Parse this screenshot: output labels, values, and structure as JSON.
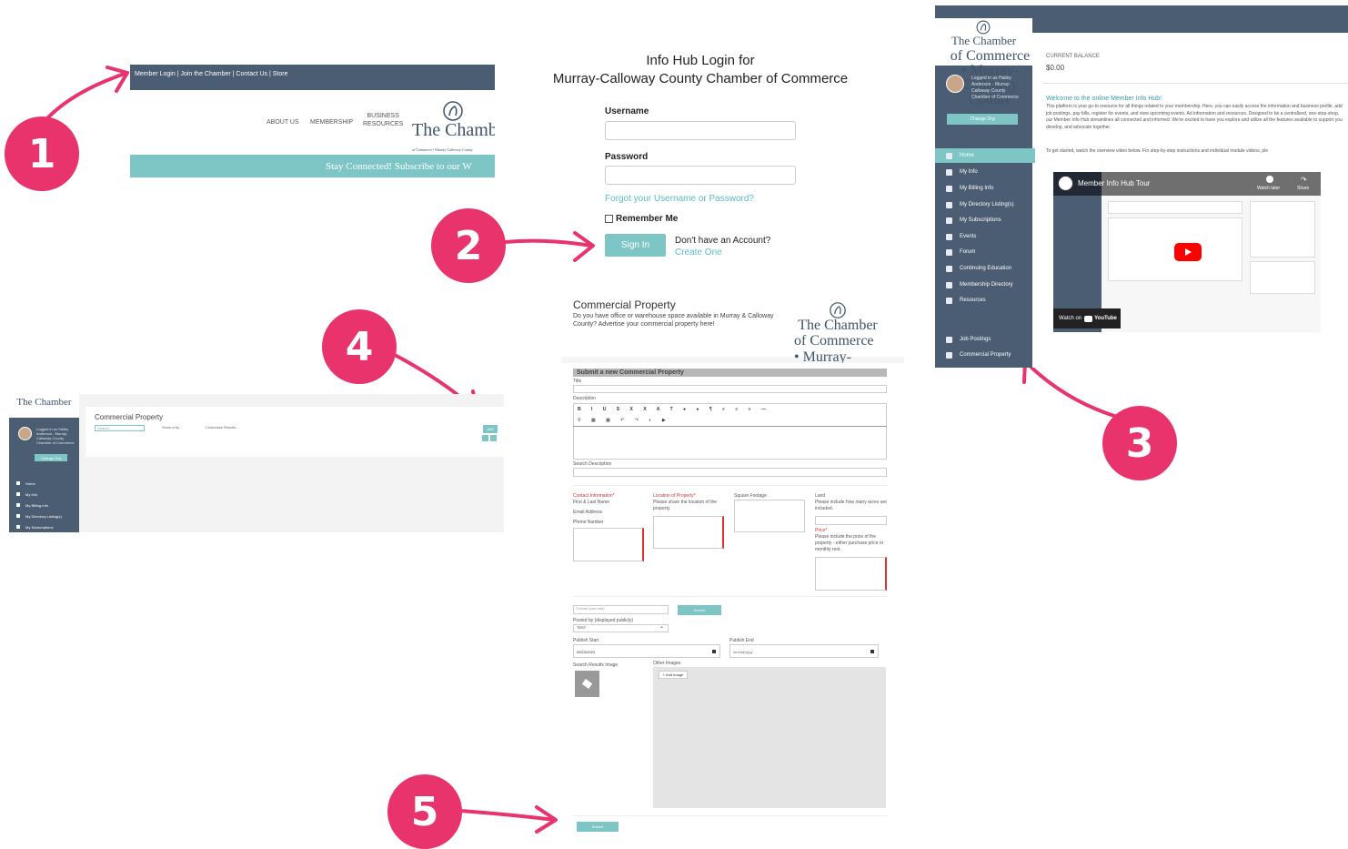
{
  "steps": [
    "1",
    "2",
    "3",
    "4",
    "5"
  ],
  "site": {
    "topbar": "Member Login | Join the Chamber | Contact Us | Store",
    "nav": [
      "ABOUT US",
      "MEMBERSHIP"
    ],
    "nav_business": [
      "BUSINESS",
      "RESOURCES"
    ],
    "logo": "The Chambe",
    "logo_sub": "of Commerce • Murray-Calloway County",
    "band": "Stay Connected! Subscribe to our W"
  },
  "login": {
    "title_line1": "Info Hub Login for",
    "title_line2": "Murray-Calloway County Chamber of Commerce",
    "username_label": "Username",
    "password_label": "Password",
    "forgot": "Forgot your Username or Password?",
    "remember": "Remember Me",
    "signin": "Sign In",
    "no_account": "Don't have an Account?",
    "create": "Create One"
  },
  "hub": {
    "logo": "The Chamber",
    "logo_sub": "of Commerce • Murray-Calloway County",
    "logged_in": "Logged in as Hailey Anderson - Murray-Calloway County Chamber of Commerce",
    "change_org": "Change Org",
    "nav": [
      "Home",
      "My Info",
      "My Billing Info",
      "My Directory Listing(s)",
      "My Subscriptions",
      "Events",
      "Forum",
      "Continuing Education",
      "Membership Directory",
      "Resources"
    ],
    "nav_bottom": [
      "Job Postings",
      "Commercial Property"
    ],
    "balance_label": "CURRENT BALANCE",
    "balance": "$0.00",
    "welcome_title": "Welcome to the online Member Info Hub!",
    "welcome_text": "This platform is your go-to resource for all things related to your membership. Here, you can easily access the information and business profile, add job postings, pay bills, register for events, and view upcoming events. Ad information and resources. Designed to be a centralized, one-stop-shop, our Member Info Hub streamlines all connected and informed. We're excited to have you explore and utilize all the features available to support you develop, and advocate together.",
    "get_started": "To get started, watch the overview video below. For step-by-step instructions and individual module videos, ple",
    "video_title": "Member Info Hub Tour",
    "watch_later": "Watch later",
    "share": "Share",
    "watch_on": "Watch on",
    "youtube": "YouTube"
  },
  "admin": {
    "logo": "The Chamber",
    "logged_in": "Logged in as Hailey Anderson - Murray-Calloway County Chamber of Commerce",
    "change_org": "Change Org",
    "title": "Commercial Property",
    "search_placeholder": "Search...",
    "show_only": "Show only...",
    "customize": "Customize Results...",
    "add": "Add",
    "nav": [
      "Home",
      "My Info",
      "My Billing Info",
      "My Directory Listing(s)",
      "My Subscriptions"
    ]
  },
  "form": {
    "title": "Commercial Property",
    "intro": "Do you have office or warehouse space available in Murray & Calloway County? Advertise your commercial property here!",
    "logo": "The Chamber",
    "logo_sub": "of Commerce • Murray-Calloway County",
    "section": "Submit a new Commercial Property",
    "title_label": "Title",
    "description_label": "Description",
    "search_desc_label": "Search Description",
    "contact_label": "Contact Information*",
    "contact_lines": [
      "First & Last Name",
      "Email Address",
      "Phone Number"
    ],
    "location_label": "Location of Property*",
    "location_help": "Please share the location of the property.",
    "sqft_label": "Square Footage",
    "land_label": "Land",
    "land_help": "Please include how many acres are included.",
    "price_label": "Price*",
    "price_help": "Please include the price of the property - either purchase price or monthly rent.",
    "contact_placeholder": "Contact (can edit)",
    "search_btn": "Search",
    "posted_by_label": "Posted by (displayed publicly)",
    "posted_by_value": "TEST",
    "publish_start_label": "Publish Start",
    "publish_start_value": "05/23/2024",
    "publish_end_label": "Publish End",
    "publish_end_value": "mm/dd/yyyy",
    "search_image_label": "Search Results Image",
    "other_images_label": "Other Images",
    "add_image": "+ Add Image",
    "submit": "Submit"
  },
  "colors": {
    "accent": "#e8336d",
    "teal": "#7ec5c5",
    "navy": "#4a5d73"
  }
}
